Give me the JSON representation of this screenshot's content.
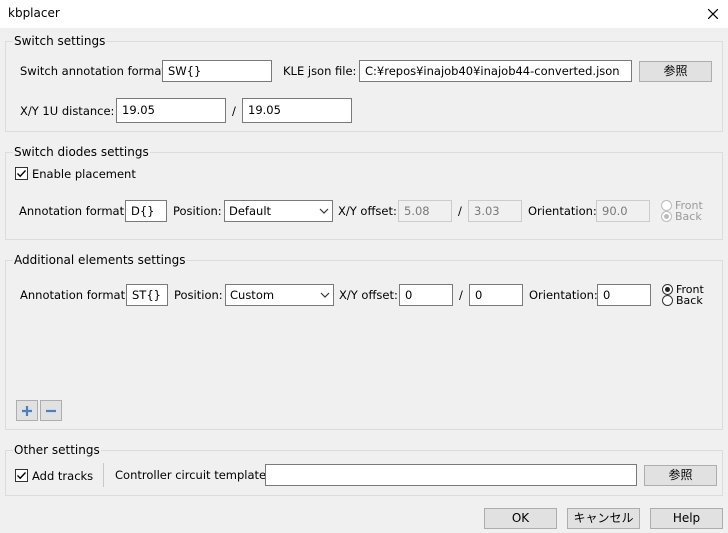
{
  "window": {
    "title": "kbplacer"
  },
  "switch_settings": {
    "title": "Switch settings",
    "annotation_label": "Switch annotation format:",
    "annotation_value": "SW{}",
    "kle_label": "KLE json file:",
    "kle_value": "C:¥repos¥inajob40¥inajob44-converted.json",
    "browse_label": "参照",
    "distance_label": "X/Y 1U distance:",
    "distance_x": "19.05",
    "distance_sep": "/",
    "distance_y": "19.05"
  },
  "diodes": {
    "title": "Switch diodes settings",
    "enable_label": "Enable placement",
    "annotation_label": "Annotation format:",
    "annotation_value": "D{}",
    "position_label": "Position:",
    "position_value": "Default",
    "offset_label": "X/Y offset:",
    "offset_x": "5.08",
    "offset_sep": "/",
    "offset_y": "3.03",
    "orientation_label": "Orientation:",
    "orientation_value": "90.0",
    "front_label": "Front",
    "back_label": "Back"
  },
  "additional": {
    "title": "Additional elements settings",
    "annotation_label": "Annotation format:",
    "annotation_value": "ST{}",
    "position_label": "Position:",
    "position_value": "Custom",
    "offset_label": "X/Y offset:",
    "offset_x": "0",
    "offset_sep": "/",
    "offset_y": "0",
    "orientation_label": "Orientation:",
    "orientation_value": "0",
    "front_label": "Front",
    "back_label": "Back"
  },
  "other": {
    "title": "Other settings",
    "tracks_label": "Add tracks",
    "template_label": "Controller circuit template:",
    "template_value": "",
    "browse_label": "参照"
  },
  "footer": {
    "ok_label": "OK",
    "cancel_label": "キャンセル",
    "help_label": "Help"
  },
  "colors": {
    "accent_blue": "#4a7fc1",
    "disabled_text": "#7a7a7a"
  }
}
